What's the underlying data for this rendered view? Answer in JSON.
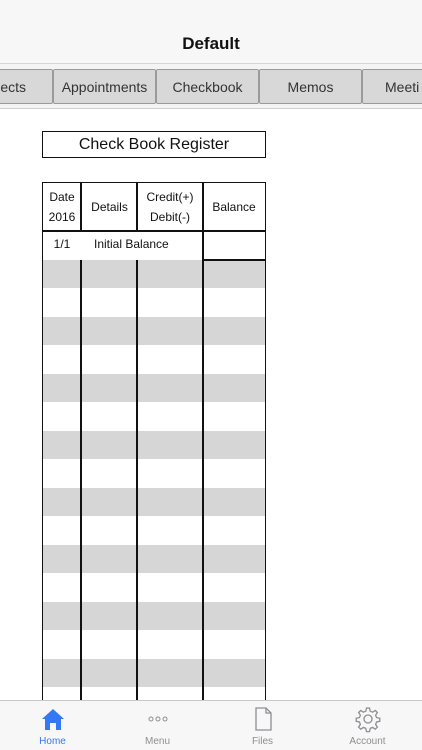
{
  "nav": {
    "title": "Default"
  },
  "tabs": [
    {
      "label": "ects"
    },
    {
      "label": "Appointments"
    },
    {
      "label": "Checkbook"
    },
    {
      "label": "Memos"
    },
    {
      "label": "Meeti"
    }
  ],
  "register": {
    "title": "Check Book Register",
    "columns": {
      "date_line1": "Date",
      "date_line2": "2016",
      "details": "Details",
      "credit_line1": "Credit(+)",
      "credit_line2": "Debit(-)",
      "balance": "Balance"
    },
    "first_row": {
      "date": "1/1",
      "details": "Initial Balance"
    }
  },
  "tab_bar": {
    "home": "Home",
    "menu": "Menu",
    "files": "Files",
    "account": "Account"
  },
  "colors": {
    "accent": "#3478f6",
    "stripe": "#d6d6d6"
  }
}
